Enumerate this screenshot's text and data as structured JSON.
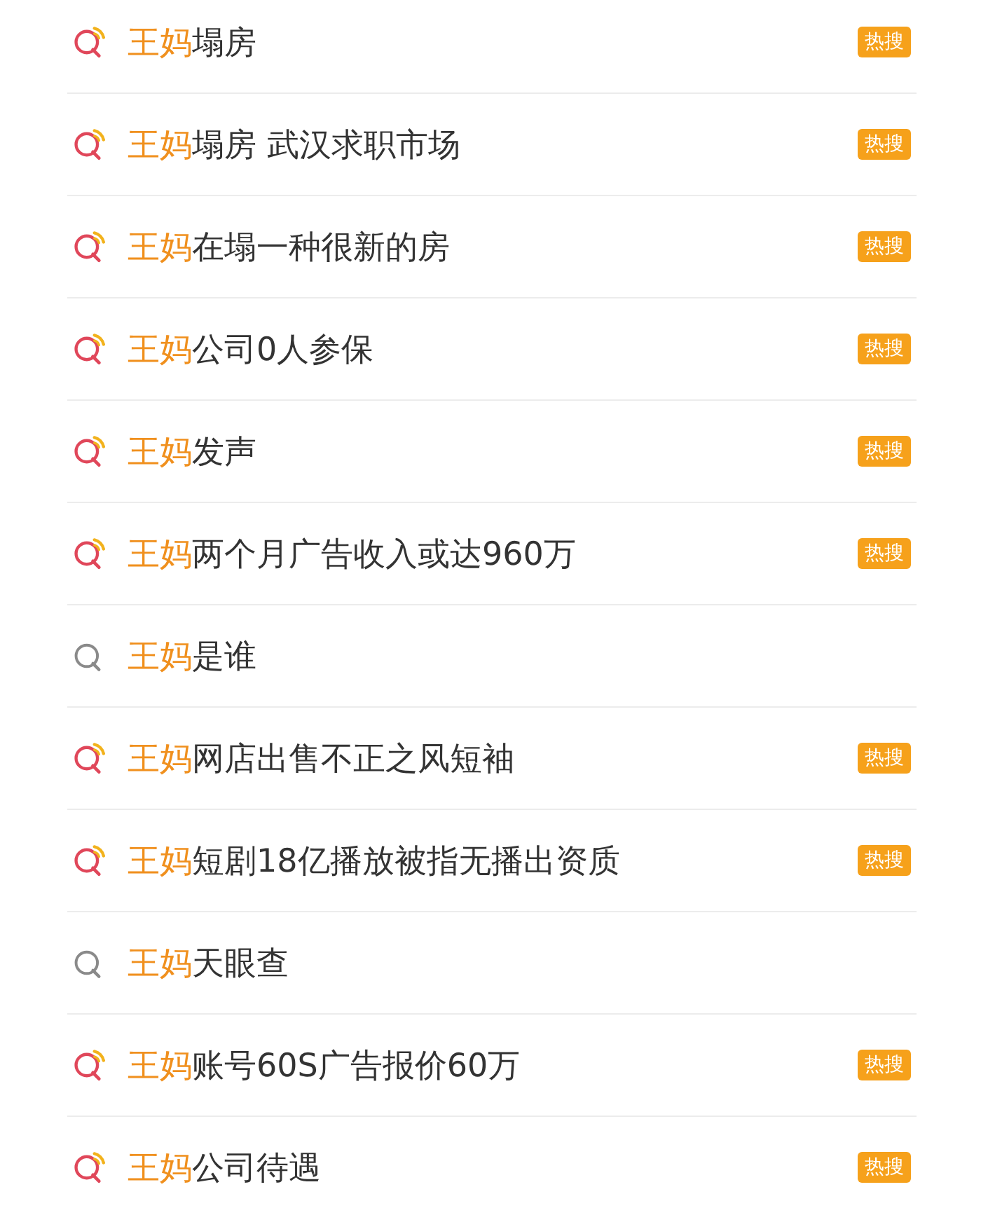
{
  "suggestions": [
    {
      "kind": "hot",
      "keyword": "王妈",
      "rest": "塌房",
      "badge": "热搜"
    },
    {
      "kind": "hot",
      "keyword": "王妈",
      "rest": "塌房 武汉求职市场",
      "badge": "热搜"
    },
    {
      "kind": "hot",
      "keyword": "王妈",
      "rest": "在塌一种很新的房",
      "badge": "热搜"
    },
    {
      "kind": "hot",
      "keyword": "王妈",
      "rest": "公司0人参保",
      "badge": "热搜"
    },
    {
      "kind": "hot",
      "keyword": "王妈",
      "rest": "发声",
      "badge": "热搜"
    },
    {
      "kind": "hot",
      "keyword": "王妈",
      "rest": "两个月广告收入或达960万",
      "badge": "热搜"
    },
    {
      "kind": "plain",
      "keyword": "王妈",
      "rest": "是谁"
    },
    {
      "kind": "hot",
      "keyword": "王妈",
      "rest": "网店出售不正之风短袖",
      "badge": "热搜"
    },
    {
      "kind": "hot",
      "keyword": "王妈",
      "rest": "短剧18亿播放被指无播出资质",
      "badge": "热搜"
    },
    {
      "kind": "plain",
      "keyword": "王妈",
      "rest": "天眼查"
    },
    {
      "kind": "hot",
      "keyword": "王妈",
      "rest": "账号60S广告报价60万",
      "badge": "热搜"
    },
    {
      "kind": "hot",
      "keyword": "王妈",
      "rest": "公司待遇",
      "badge": "热搜"
    }
  ]
}
